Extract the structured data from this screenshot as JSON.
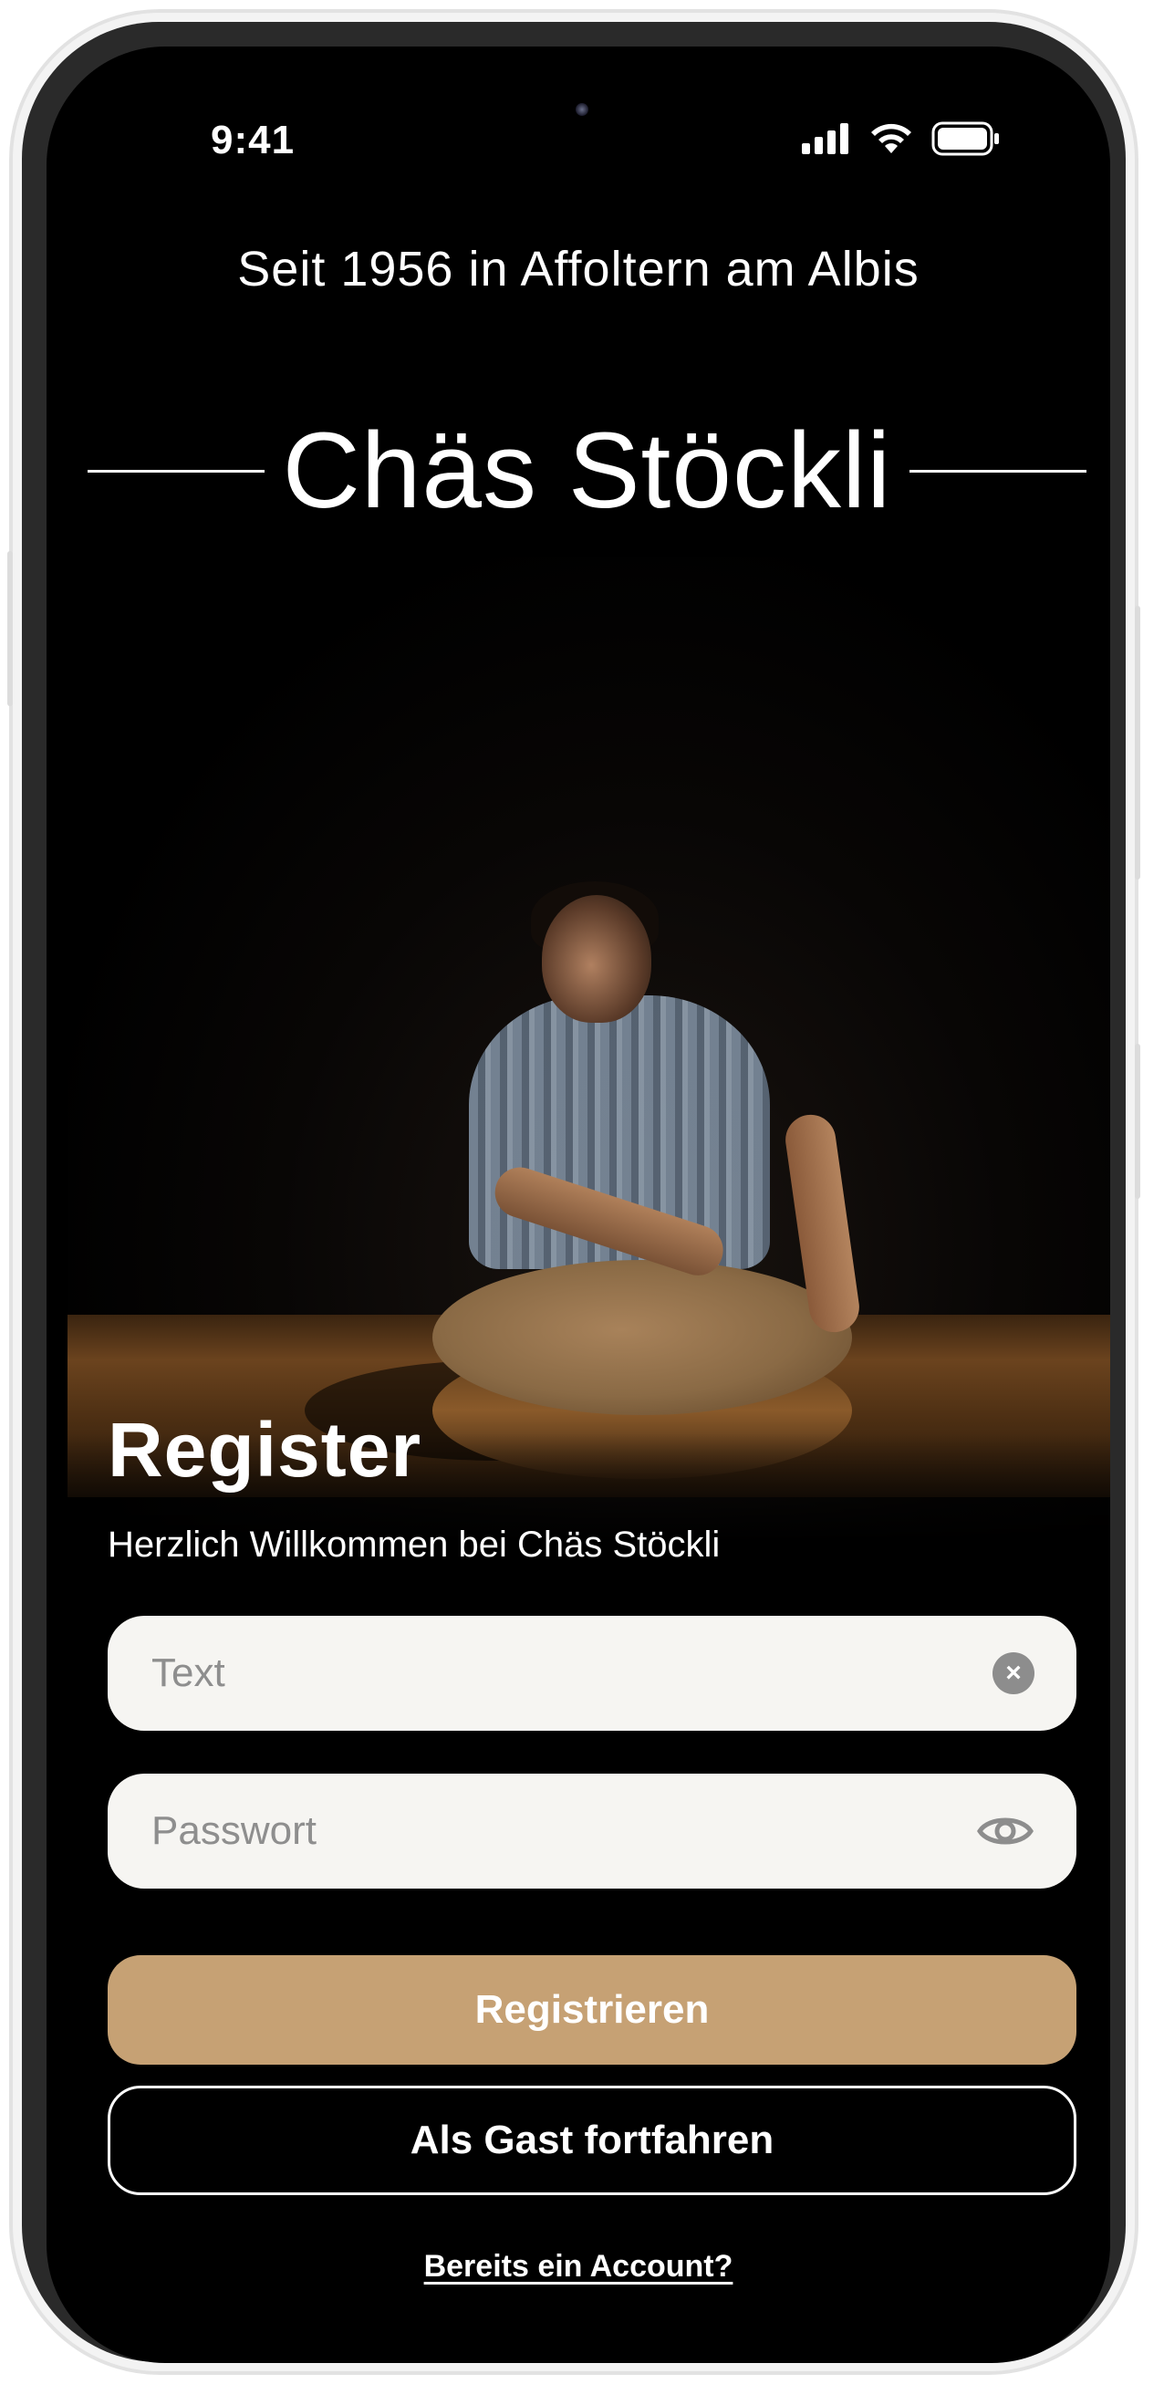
{
  "status_bar": {
    "time": "9:41"
  },
  "header": {
    "tagline": "Seit 1956 in Affoltern am Albis",
    "brand": "Chäs Stöckli"
  },
  "hero": {
    "image_description": "photo-cheesemaker-with-cheese-wheel",
    "title": "Register",
    "subtitle": "Herzlich Willkommen bei Chäs Stöckli"
  },
  "form": {
    "text_field": {
      "placeholder": "Text",
      "value": ""
    },
    "password_field": {
      "placeholder": "Passwort",
      "value": ""
    }
  },
  "actions": {
    "register_label": "Registrieren",
    "guest_label": "Als Gast fortfahren",
    "account_link": "Bereits ein Account?"
  },
  "colors": {
    "background": "#000000",
    "accent": "#c6a174",
    "input_bg": "#f6f5f2",
    "text": "#ffffff"
  },
  "icons": {
    "signal": "cellular-signal-icon",
    "wifi": "wifi-icon",
    "battery": "battery-icon",
    "clear": "clear-x-icon",
    "eye": "eye-icon"
  }
}
